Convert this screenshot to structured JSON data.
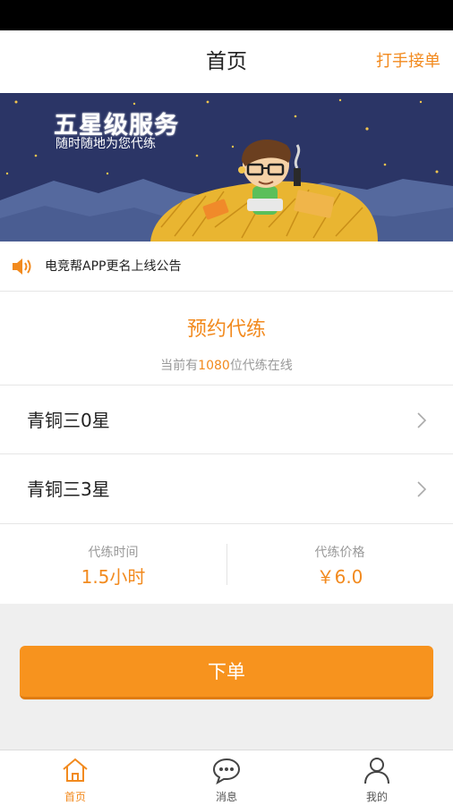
{
  "header": {
    "title": "首页",
    "action_label": "打手接单"
  },
  "banner": {
    "heading": "五星级服务",
    "subtitle": "随时随地为您代练"
  },
  "notice": {
    "icon": "speaker-icon",
    "text": "电竞帮APP更名上线公告"
  },
  "booking": {
    "title": "预约代练",
    "online_prefix": "当前有",
    "online_count": "1080",
    "online_suffix": "位代练在线"
  },
  "ranks": [
    {
      "label": "青铜三0星"
    },
    {
      "label": "青铜三3星"
    }
  ],
  "info": {
    "time_label": "代练时间",
    "time_value": "1.5小时",
    "price_label": "代练价格",
    "price_value": "￥6.0"
  },
  "order_button": "下单",
  "tabs": [
    {
      "label": "首页",
      "icon": "home-icon",
      "active": true
    },
    {
      "label": "消息",
      "icon": "chat-icon",
      "active": false
    },
    {
      "label": "我的",
      "icon": "user-icon",
      "active": false
    }
  ],
  "colors": {
    "accent": "#f28a1e",
    "button": "#f7931e",
    "banner_bg": "#2b3566"
  }
}
